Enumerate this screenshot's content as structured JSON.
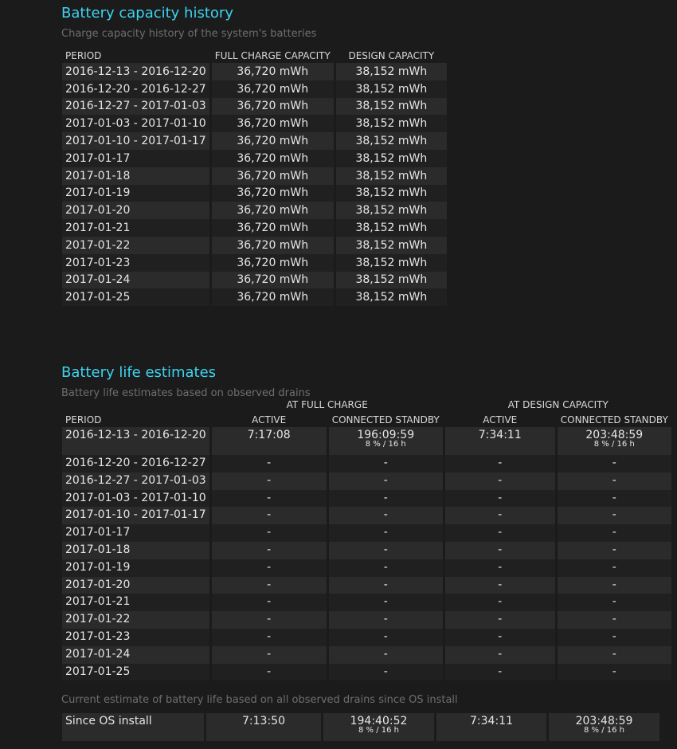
{
  "capacity_section": {
    "title": "Battery capacity history",
    "subtitle": "Charge capacity history of the system's batteries",
    "headers": [
      "PERIOD",
      "FULL CHARGE CAPACITY",
      "DESIGN CAPACITY"
    ],
    "rows": [
      [
        "2016-12-13 - 2016-12-20",
        "36,720 mWh",
        "38,152 mWh"
      ],
      [
        "2016-12-20 - 2016-12-27",
        "36,720 mWh",
        "38,152 mWh"
      ],
      [
        "2016-12-27 - 2017-01-03",
        "36,720 mWh",
        "38,152 mWh"
      ],
      [
        "2017-01-03 - 2017-01-10",
        "36,720 mWh",
        "38,152 mWh"
      ],
      [
        "2017-01-10 - 2017-01-17",
        "36,720 mWh",
        "38,152 mWh"
      ],
      [
        "2017-01-17",
        "36,720 mWh",
        "38,152 mWh"
      ],
      [
        "2017-01-18",
        "36,720 mWh",
        "38,152 mWh"
      ],
      [
        "2017-01-19",
        "36,720 mWh",
        "38,152 mWh"
      ],
      [
        "2017-01-20",
        "36,720 mWh",
        "38,152 mWh"
      ],
      [
        "2017-01-21",
        "36,720 mWh",
        "38,152 mWh"
      ],
      [
        "2017-01-22",
        "36,720 mWh",
        "38,152 mWh"
      ],
      [
        "2017-01-23",
        "36,720 mWh",
        "38,152 mWh"
      ],
      [
        "2017-01-24",
        "36,720 mWh",
        "38,152 mWh"
      ],
      [
        "2017-01-25",
        "36,720 mWh",
        "38,152 mWh"
      ]
    ]
  },
  "life_section": {
    "title": "Battery life estimates",
    "subtitle": "Battery life estimates based on observed drains",
    "group_headers": [
      "AT FULL CHARGE",
      "AT DESIGN CAPACITY"
    ],
    "headers": [
      "PERIOD",
      "ACTIVE",
      "CONNECTED STANDBY",
      "ACTIVE",
      "CONNECTED STANDBY"
    ],
    "first_row": {
      "period": "2016-12-13 - 2016-12-20",
      "full_active": "7:17:08",
      "full_standby": "196:09:59",
      "full_standby_sub": "8 % / 16 h",
      "design_active": "7:34:11",
      "design_standby": "203:48:59",
      "design_standby_sub": "8 % / 16 h"
    },
    "rows": [
      [
        "2016-12-20 - 2016-12-27",
        "-",
        "-",
        "-",
        "-"
      ],
      [
        "2016-12-27 - 2017-01-03",
        "-",
        "-",
        "-",
        "-"
      ],
      [
        "2017-01-03 - 2017-01-10",
        "-",
        "-",
        "-",
        "-"
      ],
      [
        "2017-01-10 - 2017-01-17",
        "-",
        "-",
        "-",
        "-"
      ],
      [
        "2017-01-17",
        "-",
        "-",
        "-",
        "-"
      ],
      [
        "2017-01-18",
        "-",
        "-",
        "-",
        "-"
      ],
      [
        "2017-01-19",
        "-",
        "-",
        "-",
        "-"
      ],
      [
        "2017-01-20",
        "-",
        "-",
        "-",
        "-"
      ],
      [
        "2017-01-21",
        "-",
        "-",
        "-",
        "-"
      ],
      [
        "2017-01-22",
        "-",
        "-",
        "-",
        "-"
      ],
      [
        "2017-01-23",
        "-",
        "-",
        "-",
        "-"
      ],
      [
        "2017-01-24",
        "-",
        "-",
        "-",
        "-"
      ],
      [
        "2017-01-25",
        "-",
        "-",
        "-",
        "-"
      ]
    ]
  },
  "since_install": {
    "note": "Current estimate of battery life based on all observed drains since OS install",
    "label": "Since OS install",
    "full_active": "7:13:50",
    "full_standby": "194:40:52",
    "full_standby_sub": "8 % / 16 h",
    "design_active": "7:34:11",
    "design_standby": "203:48:59",
    "design_standby_sub": "8 % / 16 h"
  },
  "colors": {
    "background": "#1b1b1b",
    "title": "#3cd4f0",
    "row_odd": "#2b2b2b",
    "row_even": "#202020"
  }
}
